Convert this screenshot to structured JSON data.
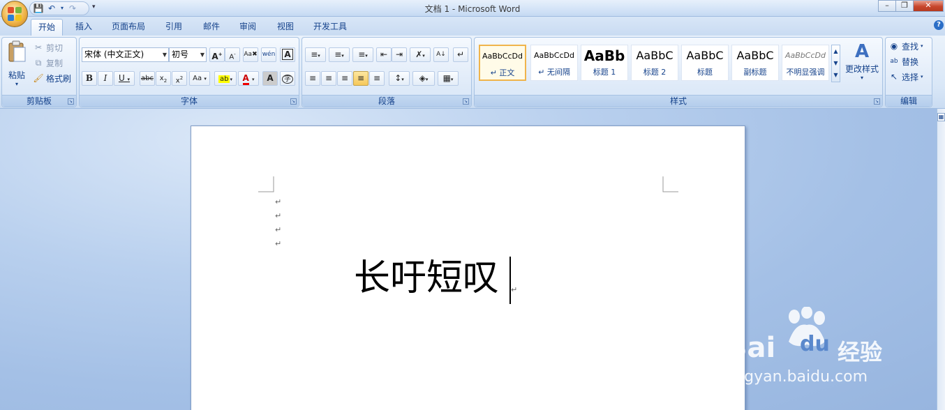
{
  "window": {
    "title": "文档 1 - Microsoft Word"
  },
  "tabs": [
    "开始",
    "插入",
    "页面布局",
    "引用",
    "邮件",
    "审阅",
    "视图",
    "开发工具"
  ],
  "ribbon": {
    "clipboard": {
      "label": "剪贴板",
      "paste": "粘贴",
      "cut": "剪切",
      "copy": "复制",
      "format_painter": "格式刷"
    },
    "font": {
      "label": "字体",
      "font_name": "宋体 (中文正文)",
      "font_size": "初号"
    },
    "paragraph": {
      "label": "段落"
    },
    "styles": {
      "label": "样式",
      "items": [
        {
          "sample": "AaBbCcDd",
          "name": "↵ 正文"
        },
        {
          "sample": "AaBbCcDd",
          "name": "↵ 无间隔"
        },
        {
          "sample": "AaBb",
          "name": "标题 1"
        },
        {
          "sample": "AaBbC",
          "name": "标题 2"
        },
        {
          "sample": "AaBbC",
          "name": "标题"
        },
        {
          "sample": "AaBbC",
          "name": "副标题"
        },
        {
          "sample": "AaBbCcDd",
          "name": "不明显强调"
        }
      ],
      "change_styles": "更改样式"
    },
    "editing": {
      "label": "编辑",
      "find": "查找",
      "replace": "替换",
      "select": "选择"
    }
  },
  "document": {
    "text": "长吁短叹"
  },
  "watermark": {
    "brand": "Bai",
    "brand2": "du",
    "suffix": "经验",
    "url": "jingyan.baidu.com"
  }
}
